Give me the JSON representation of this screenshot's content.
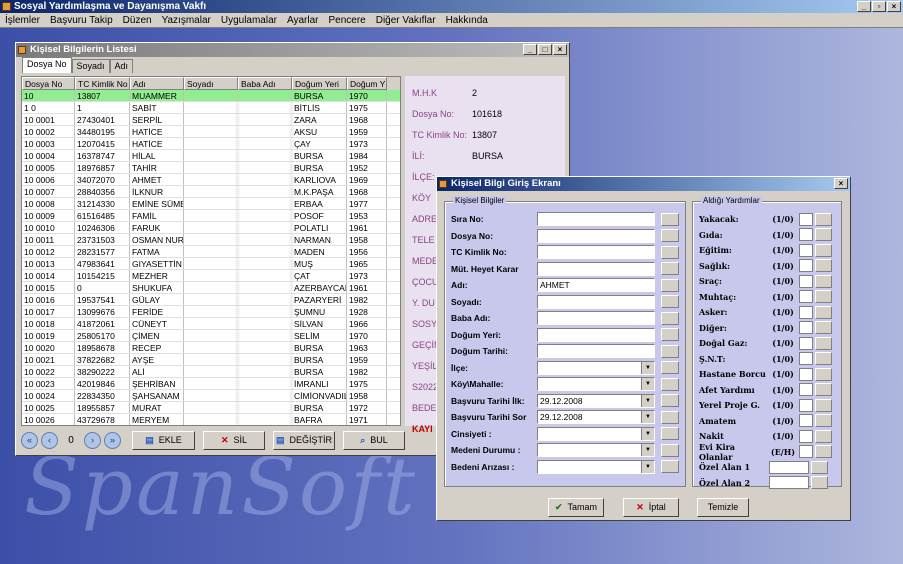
{
  "app": {
    "title": "Sosyal Yardımlaşma ve Dayanışma Vakfı",
    "background_text": "SpanSoft"
  },
  "menu": [
    "İşlemler",
    "Başvuru Takip",
    "Düzen",
    "Yazışmalar",
    "Uygulamalar",
    "Ayarlar",
    "Pencere",
    "Diğer Vakıflar",
    "Hakkında"
  ],
  "list_window": {
    "title": "Kişisel Bilgilerin Listesi",
    "tabs": [
      "Dosya No",
      "Soyadı",
      "Adı"
    ],
    "columns": [
      "Dosya No",
      "TC Kimlik No",
      "Adı",
      "Soyadı",
      "Baba Adı",
      "Doğum Yeri",
      "Doğum Yılı"
    ],
    "rows": [
      [
        "10",
        "13807",
        "MUAMMER",
        "",
        "",
        "BURSA",
        "1970"
      ],
      [
        "1 0",
        "1",
        "SABİT",
        "",
        "",
        "BİTLİS",
        "1975"
      ],
      [
        "10 0001",
        "27430401",
        "SERPİL",
        "",
        "",
        "ZARA",
        "1968"
      ],
      [
        "10 0002",
        "34480195",
        "HATİCE",
        "",
        "",
        "AKSU",
        "1959"
      ],
      [
        "10 0003",
        "12070415",
        "HATİCE",
        "",
        "",
        "ÇAY",
        "1973"
      ],
      [
        "10 0004",
        "16378747",
        "HİLAL",
        "",
        "",
        "BURSA",
        "1984"
      ],
      [
        "10 0005",
        "18976857",
        "TAHİR",
        "",
        "",
        "BURSA",
        "1952"
      ],
      [
        "10 0006",
        "34072070",
        "AHMET",
        "",
        "",
        "KARLIOVA",
        "1969"
      ],
      [
        "10 0007",
        "28840356",
        "İLKNUR",
        "",
        "",
        "M.K.PAŞA",
        "1968"
      ],
      [
        "10 0008",
        "31214330",
        "EMİNE SÜMER",
        "",
        "",
        "ERBAA",
        "1977"
      ],
      [
        "10 0009",
        "61516485",
        "FAMİL",
        "",
        "",
        "POSOF",
        "1953"
      ],
      [
        "10 0010",
        "10246306",
        "FARUK",
        "",
        "",
        "POLATLI",
        "1961"
      ],
      [
        "10 0011",
        "23731503",
        "OSMAN NURİ",
        "",
        "",
        "NARMAN",
        "1958"
      ],
      [
        "10 0012",
        "28231577",
        "FATMA",
        "",
        "",
        "MADEN",
        "1956"
      ],
      [
        "10 0013",
        "47983641",
        "GIYASETTİN",
        "",
        "",
        "MUŞ",
        "1965"
      ],
      [
        "10 0014",
        "10154215",
        "MEZHER",
        "",
        "",
        "ÇAT",
        "1973"
      ],
      [
        "10 0015",
        "0",
        "SHUKUFA",
        "",
        "",
        "AZERBAYCAN",
        "1961"
      ],
      [
        "10 0016",
        "19537541",
        "GÜLAY",
        "",
        "",
        "PAZARYERİ",
        "1982"
      ],
      [
        "10 0017",
        "13099676",
        "FERİDE",
        "",
        "",
        "ŞUMNU",
        "1928"
      ],
      [
        "10 0018",
        "41872061",
        "CÜNEYT",
        "",
        "",
        "SİLVAN",
        "1966"
      ],
      [
        "10 0019",
        "25805170",
        "ÇİMEN",
        "",
        "",
        "SELİM",
        "1970"
      ],
      [
        "10 0020",
        "18958678",
        "RECEP",
        "",
        "",
        "BURSA",
        "1963"
      ],
      [
        "10 0021",
        "37822682",
        "AYŞE",
        "",
        "",
        "BURSA",
        "1959"
      ],
      [
        "10 0022",
        "38290222",
        "ALİ",
        "",
        "",
        "BURSA",
        "1982"
      ],
      [
        "10 0023",
        "42019846",
        "ŞEHRİBAN",
        "",
        "",
        "İMRANLI",
        "1975"
      ],
      [
        "10 0024",
        "22834350",
        "ŞAHSANAM",
        "",
        "",
        "CİMİONVADIL",
        "1958"
      ],
      [
        "10 0025",
        "18955857",
        "MURAT",
        "",
        "",
        "BURSA",
        "1972"
      ],
      [
        "10 0026",
        "43729678",
        "MERYEM",
        "",
        "",
        "BAFRA",
        "1971"
      ]
    ],
    "side": [
      {
        "label": "M.H.K",
        "value": "2"
      },
      {
        "label": "Dosya No:",
        "value": "101618"
      },
      {
        "label": "TC Kimlik No:",
        "value": "13807"
      },
      {
        "label": "İLİ:",
        "value": "BURSA"
      },
      {
        "label": "İLÇE:",
        "value": ""
      },
      {
        "label": "KÖY",
        "value": ""
      },
      {
        "label": "ADRE",
        "value": ""
      },
      {
        "label": "TELE",
        "value": ""
      },
      {
        "label": "MEDE",
        "value": ""
      },
      {
        "label": "ÇOCU",
        "value": ""
      },
      {
        "label": "Y. DU",
        "value": ""
      },
      {
        "label": "SOSY",
        "value": ""
      },
      {
        "label": "GEÇİN",
        "value": ""
      },
      {
        "label": "YEŞİL",
        "value": ""
      },
      {
        "label": "S2022",
        "value": ""
      },
      {
        "label": "BEDE",
        "value": ""
      },
      {
        "label": "KAYI",
        "value": ""
      }
    ],
    "page": "0",
    "buttons": {
      "add": "EKLE",
      "delete": "SİL",
      "change": "DEĞİŞTİR",
      "find": "BUL"
    }
  },
  "form_window": {
    "title": "Kişisel Bilgi Giriş Ekranı",
    "personal_legend": "Kişisel Bilgiler",
    "aid_legend": "Aldığı Yardımlar",
    "fields": [
      {
        "label": "Sıra No:",
        "value": "",
        "dd": false
      },
      {
        "label": "Dosya No:",
        "value": "",
        "dd": false
      },
      {
        "label": "TC Kimlik No:",
        "value": "",
        "dd": false
      },
      {
        "label": "Müt. Heyet Karar",
        "value": "",
        "dd": false
      },
      {
        "label": "Adı:",
        "value": "AHMET",
        "dd": false
      },
      {
        "label": "Soyadı:",
        "value": "",
        "dd": false
      },
      {
        "label": "Baba Adı:",
        "value": "",
        "dd": false
      },
      {
        "label": "Doğum Yeri:",
        "value": "",
        "dd": false
      },
      {
        "label": "Doğum Tarihi:",
        "value": "",
        "dd": false
      },
      {
        "label": "İlçe:",
        "value": "",
        "dd": true
      },
      {
        "label": "Köy\\Mahalle:",
        "value": "",
        "dd": true
      },
      {
        "label": "Başvuru Tarihi İlk:",
        "value": "29.12.2008",
        "dd": true
      },
      {
        "label": "Başvuru Tarihi Sor",
        "value": "29.12.2008",
        "dd": true
      },
      {
        "label": "Cinsiyeti :",
        "value": "",
        "dd": true
      },
      {
        "label": "Medeni Durumu :",
        "value": "",
        "dd": true
      },
      {
        "label": "Bedeni Arızası :",
        "value": "",
        "dd": true
      }
    ],
    "aids": [
      {
        "label": "Yakacak:",
        "unit": "(1/0)"
      },
      {
        "label": "Gıda:",
        "unit": "(1/0)"
      },
      {
        "label": "Eğitim:",
        "unit": "(1/0)"
      },
      {
        "label": "Sağlık:",
        "unit": "(1/0)"
      },
      {
        "label": "Sraç:",
        "unit": "(1/0)"
      },
      {
        "label": "Muhtaç:",
        "unit": "(1/0)"
      },
      {
        "label": "Asker:",
        "unit": "(1/0)"
      },
      {
        "label": "Diğer:",
        "unit": "(1/0)"
      },
      {
        "label": "Doğal Gaz:",
        "unit": "(1/0)"
      },
      {
        "label": "Ş.N.T:",
        "unit": "(1/0)"
      },
      {
        "label": "Hastane Borcu",
        "unit": "(1/0)"
      },
      {
        "label": "Afet Yardımı",
        "unit": "(1/0)"
      },
      {
        "label": "Yerel Proje G.",
        "unit": "(1/0)"
      },
      {
        "label": "Amatem",
        "unit": "(1/0)"
      },
      {
        "label": "Nakit",
        "unit": "(1/0)"
      },
      {
        "label": "Evi Kira Olanlar",
        "unit": "(E/H)"
      }
    ],
    "special": [
      "Özel Alan 1",
      "Özel Alan 2"
    ],
    "buttons": {
      "ok": "Tamam",
      "cancel": "İptal",
      "clear": "Temizle"
    }
  }
}
